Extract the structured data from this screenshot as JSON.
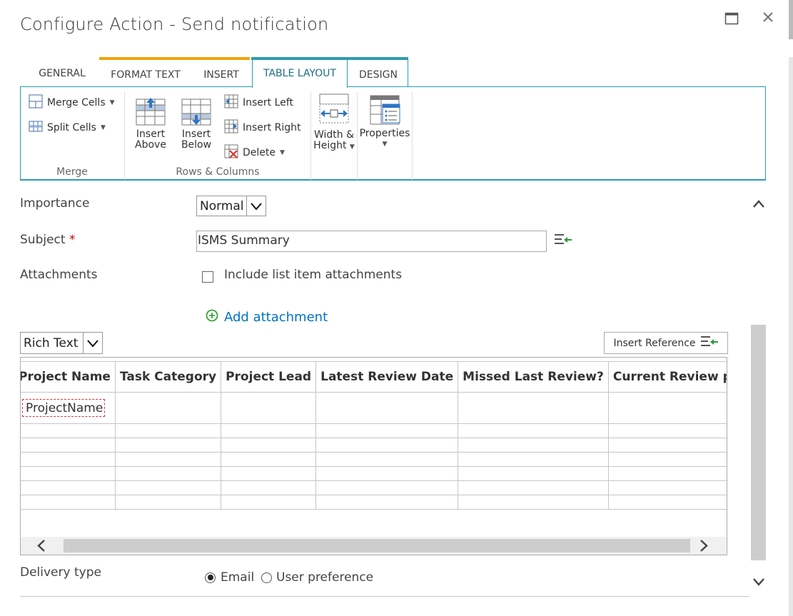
{
  "dialog": {
    "title": "Configure Action - Send notification",
    "maximize_icon": "maximize-icon",
    "close_icon": "close-icon"
  },
  "ribbon": {
    "tabs": [
      {
        "label": "GENERAL"
      },
      {
        "label": "FORMAT TEXT"
      },
      {
        "label": "INSERT"
      },
      {
        "label": "TABLE LAYOUT"
      },
      {
        "label": "DESIGN"
      }
    ],
    "merge_group": {
      "merge_cells": "Merge Cells",
      "split_cells": "Split Cells",
      "label": "Merge"
    },
    "rows_columns_group": {
      "insert_above_1": "Insert",
      "insert_above_2": "Above",
      "insert_below_1": "Insert",
      "insert_below_2": "Below",
      "insert_left": "Insert Left",
      "insert_right": "Insert Right",
      "delete": "Delete",
      "label": "Rows & Columns"
    },
    "width_height_1": "Width &",
    "width_height_2": "Height",
    "properties": "Properties"
  },
  "form": {
    "importance": {
      "label": "Importance",
      "value": "Normal"
    },
    "subject": {
      "label": "Subject",
      "required_mark": "*",
      "value": "ISMS Summary"
    },
    "attachments": {
      "label": "Attachments",
      "checkbox_label": "Include list item attachments",
      "checked": false
    },
    "add_attachment": "Add attachment",
    "body_format": "Rich Text",
    "insert_reference": "Insert Reference",
    "delivery_type": {
      "label": "Delivery type",
      "options": [
        {
          "label": "Email",
          "selected": true
        },
        {
          "label": "User preference",
          "selected": false
        }
      ]
    }
  },
  "body_table": {
    "columns": [
      "Project Name",
      "Task Category",
      "Project Lead",
      "Latest Review Date",
      "Missed Last Review?",
      "Current Review period"
    ],
    "first_row_field": "ProjectName",
    "empty_rows": 6
  },
  "colors": {
    "accent": "#2a9db0",
    "contextual": "#f0a30a",
    "link": "#0072c6",
    "required": "#cc0000",
    "add_icon": "#3aa53a"
  }
}
